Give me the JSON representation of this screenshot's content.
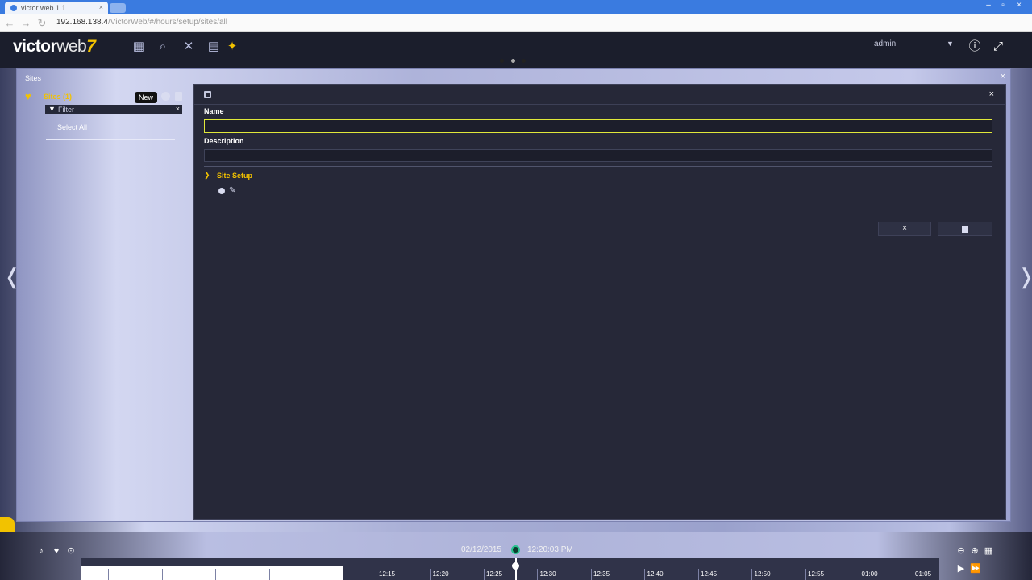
{
  "browser": {
    "tab_title": "victor web 1.1",
    "url_host": "192.168.138.4",
    "url_path": "/VictorWeb/#/hours/setup/sites/all"
  },
  "header": {
    "logo_main": "victor",
    "logo_web": "web",
    "logo_mark": "7",
    "user": "admin"
  },
  "sites_panel": {
    "title": "Sites",
    "list_label": "Sites (1)",
    "new_tooltip": "New",
    "filter_placeholder": "Filter",
    "select_all": "Select All"
  },
  "editor": {
    "name_label": "Name",
    "name_value": "",
    "description_label": "Description",
    "description_value": "",
    "section_label": "Site Setup"
  },
  "timeline": {
    "date": "02/12/2015",
    "time": "12:20:03 PM",
    "labels": [
      "12:15",
      "12:20",
      "12:25",
      "12:30",
      "12:35",
      "12:40",
      "12:45",
      "12:50",
      "12:55",
      "01:00",
      "01:05"
    ]
  }
}
